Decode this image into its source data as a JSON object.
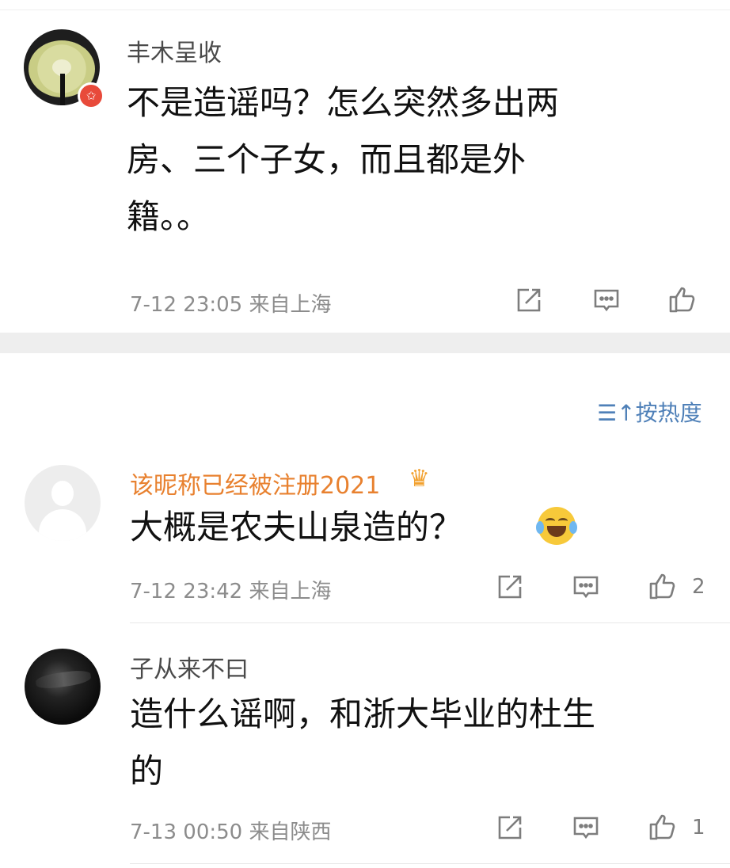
{
  "comments": [
    {
      "username": "丰木呈收",
      "badge_icon": "star-badge-icon",
      "text_lines": [
        "不是造谣吗？怎么突然多出两",
        "房、三个子女，而且都是外",
        "籍。。"
      ],
      "time": "7-12 23:05",
      "location": "来自上海",
      "likes": ""
    },
    {
      "username": "该昵称已经被注册2021",
      "vip_icon": "crown-icon",
      "text": "大概是农夫山泉造的？",
      "emoji": "laughing-crying-emoji",
      "time": "7-12 23:42",
      "location": "来自上海",
      "likes": "2"
    },
    {
      "username": "子从来不曰",
      "text_lines": [
        "造什么谣啊，和浙大毕业的杜生",
        "的"
      ],
      "time": "7-13 00:50",
      "location": "来自陕西",
      "likes": "1"
    }
  ],
  "sort": {
    "icon": "sort-icon",
    "label": "按热度"
  },
  "colors": {
    "vip_name": "#e8812f",
    "sort_link": "#4f80b8",
    "separator": "#eeeeee"
  }
}
